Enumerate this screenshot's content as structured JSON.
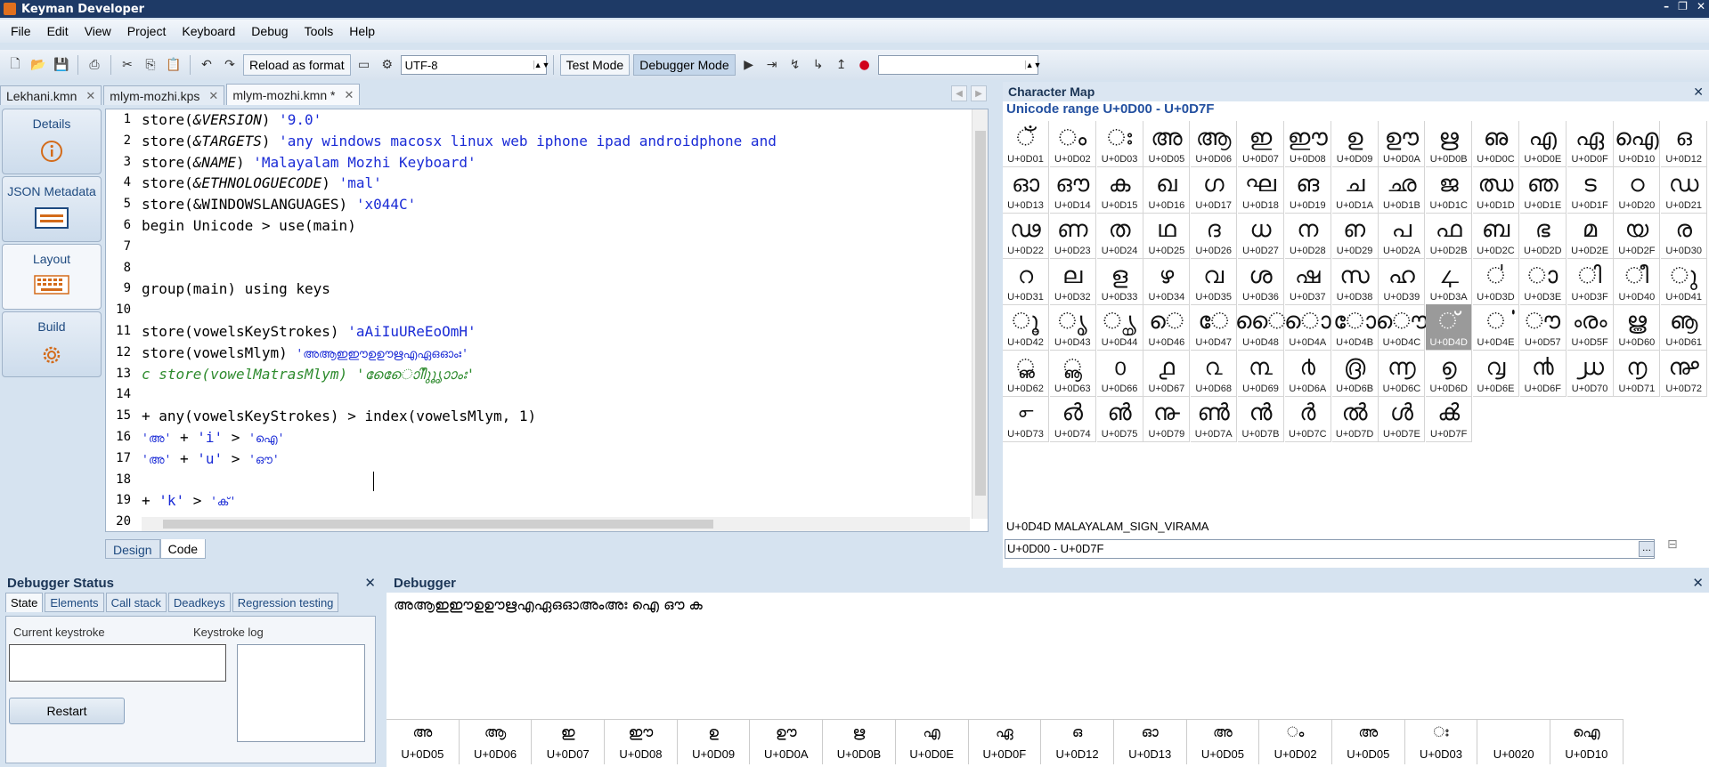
{
  "window": {
    "title": "Keyman Developer"
  },
  "menu": [
    "File",
    "Edit",
    "View",
    "Project",
    "Keyboard",
    "Debug",
    "Tools",
    "Help"
  ],
  "toolbar": {
    "reload_label": "Reload as format",
    "encoding": "UTF-8",
    "test_mode": "Test Mode",
    "debugger_mode": "Debugger Mode",
    "search_value": ""
  },
  "doc_tabs": [
    {
      "label": "Lekhani.kmn"
    },
    {
      "label": "mlym-mozhi.kps"
    },
    {
      "label": "mlym-mozhi.kmn *"
    }
  ],
  "side": [
    {
      "label": "Details",
      "icon": "info-icon"
    },
    {
      "label": "JSON Metadata",
      "icon": "metadata-icon"
    },
    {
      "label": "Layout",
      "icon": "keyboard-icon"
    },
    {
      "label": "Build",
      "icon": "gear-icon"
    }
  ],
  "editor": {
    "line_numbers": [
      "1",
      "2",
      "3",
      "4",
      "5",
      "6",
      "7",
      "8",
      "9",
      "10",
      "11",
      "12",
      "13",
      "14",
      "15",
      "16",
      "17",
      "18",
      "19",
      "20"
    ],
    "lines": [
      [
        {
          "t": "store(",
          "c": "kw"
        },
        {
          "t": "&VERSION",
          "c": "it"
        },
        {
          "t": ") ",
          "c": "kw"
        },
        {
          "t": "'9.0'",
          "c": "str"
        }
      ],
      [
        {
          "t": "store(",
          "c": "kw"
        },
        {
          "t": "&TARGETS",
          "c": "it"
        },
        {
          "t": ") ",
          "c": "kw"
        },
        {
          "t": "'any windows macosx linux web iphone ipad androidphone and",
          "c": "str"
        }
      ],
      [
        {
          "t": "store(",
          "c": "kw"
        },
        {
          "t": "&NAME",
          "c": "it"
        },
        {
          "t": ") ",
          "c": "kw"
        },
        {
          "t": "'Malayalam Mozhi Keyboard'",
          "c": "str"
        }
      ],
      [
        {
          "t": "store(",
          "c": "kw"
        },
        {
          "t": "&ETHNOLOGUECODE",
          "c": "it"
        },
        {
          "t": ") ",
          "c": "kw"
        },
        {
          "t": "'mal'",
          "c": "str"
        }
      ],
      [
        {
          "t": "store(&WINDOWSLANGUAGES) ",
          "c": "kw"
        },
        {
          "t": "'x044C'",
          "c": "str"
        }
      ],
      [
        {
          "t": "begin Unicode > use(main)",
          "c": "kw"
        }
      ],
      [],
      [],
      [
        {
          "t": "group(main) using keys",
          "c": "kw"
        }
      ],
      [],
      [
        {
          "t": "store(vowelsKeyStrokes) ",
          "c": "kw"
        },
        {
          "t": "'aAiIuUReEoOmH'",
          "c": "str"
        }
      ],
      [
        {
          "t": "store(vowelsMlym)        ",
          "c": "kw"
        },
        {
          "t": "'അആഇഈഉഊഋഎഏഒഓംഃ'",
          "c": "str small"
        }
      ],
      [
        {
          "t": "c store(vowelMatrasMlym) 'ാിീുൂൃെേൊോംഃ'",
          "c": "cmt"
        }
      ],
      [],
      [
        {
          "t": "+ any(vowelsKeyStrokes) > index(vowelsMlym, 1)",
          "c": "kw"
        }
      ],
      [
        {
          "t": "'അ'",
          "c": "str small"
        },
        {
          "t": " + ",
          "c": "kw"
        },
        {
          "t": "'i'",
          "c": "str"
        },
        {
          "t": " > ",
          "c": "kw"
        },
        {
          "t": "'ഐ'",
          "c": "str small"
        }
      ],
      [
        {
          "t": "'അ'",
          "c": "str small"
        },
        {
          "t": " + ",
          "c": "kw"
        },
        {
          "t": "'u'",
          "c": "str"
        },
        {
          "t": " > ",
          "c": "kw"
        },
        {
          "t": "'ഔ'",
          "c": "str small"
        }
      ],
      [],
      [
        {
          "t": "+ ",
          "c": "kw"
        },
        {
          "t": "'k'",
          "c": "str"
        },
        {
          "t": " > ",
          "c": "kw"
        },
        {
          "t": "'ക്'",
          "c": "str small"
        }
      ],
      []
    ]
  },
  "editor_tabs": [
    "Design",
    "Code"
  ],
  "charmap": {
    "title": "Character Map",
    "range_title": "Unicode range U+0D00 - U+0D7F",
    "selected_info": "U+0D4D MALAYALAM_SIGN_VIRAMA",
    "range_input": "U+0D00 - U+0D7F",
    "cells": [
      [
        "ഁ",
        "U+0D01"
      ],
      [
        "ം",
        "U+0D02"
      ],
      [
        "ഃ",
        "U+0D03"
      ],
      [
        "അ",
        "U+0D05"
      ],
      [
        "ആ",
        "U+0D06"
      ],
      [
        "ഇ",
        "U+0D07"
      ],
      [
        "ഈ",
        "U+0D08"
      ],
      [
        "ഉ",
        "U+0D09"
      ],
      [
        "ഊ",
        "U+0D0A"
      ],
      [
        "ഋ",
        "U+0D0B"
      ],
      [
        "ഌ",
        "U+0D0C"
      ],
      [
        "എ",
        "U+0D0E"
      ],
      [
        "ഏ",
        "U+0D0F"
      ],
      [
        "ഐ",
        "U+0D10"
      ],
      [
        "ഒ",
        "U+0D12"
      ],
      [
        "ഓ",
        "U+0D13"
      ],
      [
        "ഔ",
        "U+0D14"
      ],
      [
        "ക",
        "U+0D15"
      ],
      [
        "ഖ",
        "U+0D16"
      ],
      [
        "ഗ",
        "U+0D17"
      ],
      [
        "ഘ",
        "U+0D18"
      ],
      [
        "ങ",
        "U+0D19"
      ],
      [
        "ച",
        "U+0D1A"
      ],
      [
        "ഛ",
        "U+0D1B"
      ],
      [
        "ജ",
        "U+0D1C"
      ],
      [
        "ഝ",
        "U+0D1D"
      ],
      [
        "ഞ",
        "U+0D1E"
      ],
      [
        "ട",
        "U+0D1F"
      ],
      [
        "ഠ",
        "U+0D20"
      ],
      [
        "ഡ",
        "U+0D21"
      ],
      [
        "ഢ",
        "U+0D22"
      ],
      [
        "ണ",
        "U+0D23"
      ],
      [
        "ത",
        "U+0D24"
      ],
      [
        "ഥ",
        "U+0D25"
      ],
      [
        "ദ",
        "U+0D26"
      ],
      [
        "ധ",
        "U+0D27"
      ],
      [
        "ന",
        "U+0D28"
      ],
      [
        "ഩ",
        "U+0D29"
      ],
      [
        "പ",
        "U+0D2A"
      ],
      [
        "ഫ",
        "U+0D2B"
      ],
      [
        "ബ",
        "U+0D2C"
      ],
      [
        "ഭ",
        "U+0D2D"
      ],
      [
        "മ",
        "U+0D2E"
      ],
      [
        "യ",
        "U+0D2F"
      ],
      [
        "ര",
        "U+0D30"
      ],
      [
        "റ",
        "U+0D31"
      ],
      [
        "ല",
        "U+0D32"
      ],
      [
        "ള",
        "U+0D33"
      ],
      [
        "ഴ",
        "U+0D34"
      ],
      [
        "വ",
        "U+0D35"
      ],
      [
        "ശ",
        "U+0D36"
      ],
      [
        "ഷ",
        "U+0D37"
      ],
      [
        "സ",
        "U+0D38"
      ],
      [
        "ഹ",
        "U+0D39"
      ],
      [
        "ഺ",
        "U+0D3A"
      ],
      [
        "഻",
        "U+0D3D"
      ],
      [
        "ാ",
        "U+0D3E"
      ],
      [
        "ി",
        "U+0D3F"
      ],
      [
        "ീ",
        "U+0D40"
      ],
      [
        "ു",
        "U+0D41"
      ],
      [
        "ൂ",
        "U+0D42"
      ],
      [
        "ൃ",
        "U+0D43"
      ],
      [
        "ൄ",
        "U+0D44"
      ],
      [
        "െ",
        "U+0D46"
      ],
      [
        "േ",
        "U+0D47"
      ],
      [
        "ൈ",
        "U+0D48"
      ],
      [
        "ൊ",
        "U+0D4A"
      ],
      [
        "ോ",
        "U+0D4B"
      ],
      [
        "ൌ",
        "U+0D4C"
      ],
      [
        "്",
        "U+0D4D"
      ],
      [
        "ൎ",
        "U+0D4E"
      ],
      [
        "ൗ",
        "U+0D57"
      ],
      [
        "ൟ",
        "U+0D5F"
      ],
      [
        "ൠ",
        "U+0D60"
      ],
      [
        "ൡ",
        "U+0D61"
      ],
      [
        "ൢ",
        "U+0D62"
      ],
      [
        "ൣ",
        "U+0D63"
      ],
      [
        "൦",
        "U+0D66"
      ],
      [
        "൧",
        "U+0D67"
      ],
      [
        "൨",
        "U+0D68"
      ],
      [
        "൩",
        "U+0D69"
      ],
      [
        "൪",
        "U+0D6A"
      ],
      [
        "൫",
        "U+0D6B"
      ],
      [
        "൬",
        "U+0D6C"
      ],
      [
        "൭",
        "U+0D6D"
      ],
      [
        "൮",
        "U+0D6E"
      ],
      [
        "൯",
        "U+0D6F"
      ],
      [
        "൰",
        "U+0D70"
      ],
      [
        "൱",
        "U+0D71"
      ],
      [
        "൲",
        "U+0D72"
      ],
      [
        "൳",
        "U+0D73"
      ],
      [
        "൴",
        "U+0D74"
      ],
      [
        "൵",
        "U+0D75"
      ],
      [
        "൹",
        "U+0D79"
      ],
      [
        "ൺ",
        "U+0D7A"
      ],
      [
        "ൻ",
        "U+0D7B"
      ],
      [
        "ർ",
        "U+0D7C"
      ],
      [
        "ൽ",
        "U+0D7D"
      ],
      [
        "ൾ",
        "U+0D7E"
      ],
      [
        "ൿ",
        "U+0D7F"
      ]
    ]
  },
  "debug_status": {
    "title": "Debugger Status",
    "tabs": [
      "State",
      "Elements",
      "Call stack",
      "Deadkeys",
      "Regression testing"
    ],
    "current_keystroke_label": "Current keystroke",
    "keystroke_log_label": "Keystroke log",
    "restart": "Restart"
  },
  "debugger": {
    "title": "Debugger",
    "text": "അആഇഈഉഊഋഎഏഒഓഅംഅഃ ഐ ഔ ക",
    "chars": [
      [
        "അ",
        "U+0D05"
      ],
      [
        "ആ",
        "U+0D06"
      ],
      [
        "ഇ",
        "U+0D07"
      ],
      [
        "ഈ",
        "U+0D08"
      ],
      [
        "ഉ",
        "U+0D09"
      ],
      [
        "ഊ",
        "U+0D0A"
      ],
      [
        "ഋ",
        "U+0D0B"
      ],
      [
        "എ",
        "U+0D0E"
      ],
      [
        "ഏ",
        "U+0D0F"
      ],
      [
        "ഒ",
        "U+0D12"
      ],
      [
        "ഓ",
        "U+0D13"
      ],
      [
        "അ",
        "U+0D05"
      ],
      [
        "ം",
        "U+0D02"
      ],
      [
        "അ",
        "U+0D05"
      ],
      [
        "ഃ",
        "U+0D03"
      ],
      [
        "",
        "U+0020"
      ],
      [
        "ഐ",
        "U+0D10"
      ]
    ]
  }
}
